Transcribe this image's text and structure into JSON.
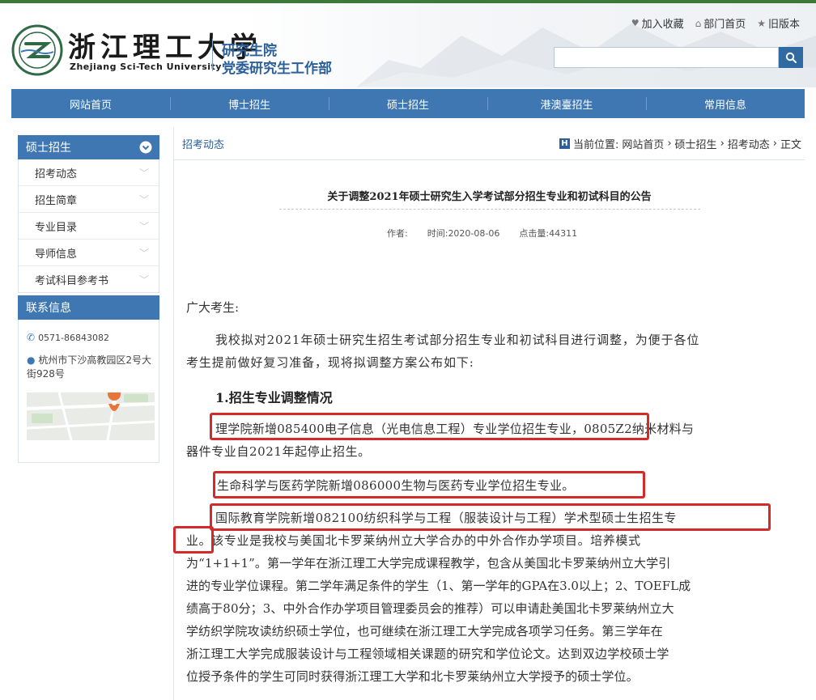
{
  "header": {
    "school_name": "浙江理工大学",
    "school_en": "Zhejiang Sci-Tech University",
    "dept_line1": "研究生院",
    "dept_line2": "党委研究生工作部",
    "top_links": [
      "加入收藏",
      "部门首页",
      "旧版本"
    ]
  },
  "nav": {
    "items": [
      "网站首页",
      "博士招生",
      "硕士招生",
      "港澳臺招生",
      "常用信息"
    ]
  },
  "sidebar": {
    "section_title": "硕士招生",
    "items": [
      "招考动态",
      "招生简章",
      "专业目录",
      "导师信息",
      "考试科目参考书"
    ],
    "contact_title": "联系信息",
    "phone": "0571-86843082",
    "address": "杭州市下沙高教园区2号大街928号"
  },
  "main": {
    "section_title": "招考动态",
    "breadcrumb": {
      "label": "当前位置:",
      "items": [
        "网站首页",
        "硕士招生",
        "招考动态",
        "正文"
      ]
    },
    "article": {
      "title": "关于调整2021年硕士研究生入学考试部分招生专业和初试科目的公告",
      "author_label": "作者:",
      "time_label": "时间:",
      "time": "2020-08-06",
      "views_label": "点击量:",
      "views": "44311",
      "lines": [
        "广大考生:",
        "我校拟对2021年硕士研究生招生考试部分招生专业和初试科目进行调整，为便于各位",
        "考生提前做好复习准备，现将拟调整方案公布如下:",
        "1.招生专业调整情况",
        "理学院新增085400电子信息（光电信息工程）专业学位招生专业，0805Z2纳米材料与",
        "器件专业自2021年起停止招生。",
        "生命科学与医药学院新增086000生物与医药专业学位招生专业。",
        "国际教育学院新增082100纺织科学与工程（服装设计与工程）学术型硕士生招生专",
        "业。该专业是我校与美国北卡罗莱纳州立大学合办的中外合作办学项目。培养模式",
        "为“1+1+1”。第一学年在浙江理工大学完成课程教学，包含从美国北卡罗莱纳州立大学引",
        "进的专业学位课程。第二学年满足条件的学生（1、第一学年的GPA在3.0以上；2、TOEFL成",
        "绩高于80分；3、中外合作办学项目管理委员会的推荐）可以申请赴美国北卡罗莱纳州立大",
        "学纺织学院攻读纺织硕士学位，也可继续在浙江理工大学完成各项学习任务。第三学年在",
        "浙江理工大学完成服装设计与工程领域相关课题的研究和学位论文。达到双边学校硕士学",
        "位授予条件的学生可同时获得浙江理工大学和北卡罗莱纳州立大学授予的硕士学位。"
      ]
    }
  },
  "colors": {
    "nav_blue": "#3f77b3",
    "accent_green": "#3d7a3a",
    "highlight_red": "#d42a2a"
  }
}
